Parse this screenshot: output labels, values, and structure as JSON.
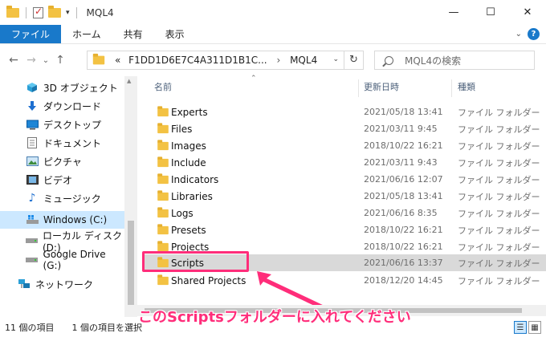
{
  "window": {
    "title": "MQL4"
  },
  "ribbon": {
    "tabs": [
      "ファイル",
      "ホーム",
      "共有",
      "表示"
    ],
    "help": "?"
  },
  "address": {
    "path1": "F1DD1D6E7C4A311D1B1C...",
    "path2": "MQL4",
    "back": "←",
    "forward": "→",
    "recent": "⌄",
    "up": "↑",
    "overflow": "«",
    "refresh": "↻"
  },
  "search": {
    "placeholder": "MQL4の検索"
  },
  "nav": {
    "items": [
      {
        "label": "3D オブジェクト",
        "icon": "cube-icon"
      },
      {
        "label": "ダウンロード",
        "icon": "download-icon"
      },
      {
        "label": "デスクトップ",
        "icon": "desktop-icon"
      },
      {
        "label": "ドキュメント",
        "icon": "document-icon"
      },
      {
        "label": "ピクチャ",
        "icon": "picture-icon"
      },
      {
        "label": "ビデオ",
        "icon": "video-icon"
      },
      {
        "label": "ミュージック",
        "icon": "music-icon"
      },
      {
        "label": "Windows (C:)",
        "icon": "drive-icon",
        "selected": true
      },
      {
        "label": "ローカル ディスク (D:)",
        "icon": "drive-icon"
      },
      {
        "label": "Google Drive (G:)",
        "icon": "drive-icon"
      },
      {
        "label": "ネットワーク",
        "icon": "network-icon"
      }
    ]
  },
  "columns": {
    "name": "名前",
    "date": "更新日時",
    "type": "種類"
  },
  "files": [
    {
      "name": "Experts",
      "date": "2021/05/18 13:41",
      "type": "ファイル フォルダー"
    },
    {
      "name": "Files",
      "date": "2021/03/11 9:45",
      "type": "ファイル フォルダー"
    },
    {
      "name": "Images",
      "date": "2018/10/22 16:21",
      "type": "ファイル フォルダー"
    },
    {
      "name": "Include",
      "date": "2021/03/11 9:43",
      "type": "ファイル フォルダー"
    },
    {
      "name": "Indicators",
      "date": "2021/06/16 12:07",
      "type": "ファイル フォルダー"
    },
    {
      "name": "Libraries",
      "date": "2021/05/18 13:41",
      "type": "ファイル フォルダー"
    },
    {
      "name": "Logs",
      "date": "2021/06/16 8:35",
      "type": "ファイル フォルダー"
    },
    {
      "name": "Presets",
      "date": "2018/10/22 16:21",
      "type": "ファイル フォルダー"
    },
    {
      "name": "Projects",
      "date": "2018/10/22 16:21",
      "type": "ファイル フォルダー"
    },
    {
      "name": "Scripts",
      "date": "2021/06/16 13:37",
      "type": "ファイル フォルダー",
      "selected": true
    },
    {
      "name": "Shared Projects",
      "date": "2018/12/20 14:45",
      "type": "ファイル フォルダー"
    }
  ],
  "annotation": {
    "text": "このScriptsフォルダーに入れてください",
    "color": "#ff2d7a"
  },
  "status": {
    "count": "11 個の項目",
    "selection": "1 個の項目を選択"
  },
  "colors": {
    "accent": "#1979ca",
    "selection": "#cce8ff"
  }
}
